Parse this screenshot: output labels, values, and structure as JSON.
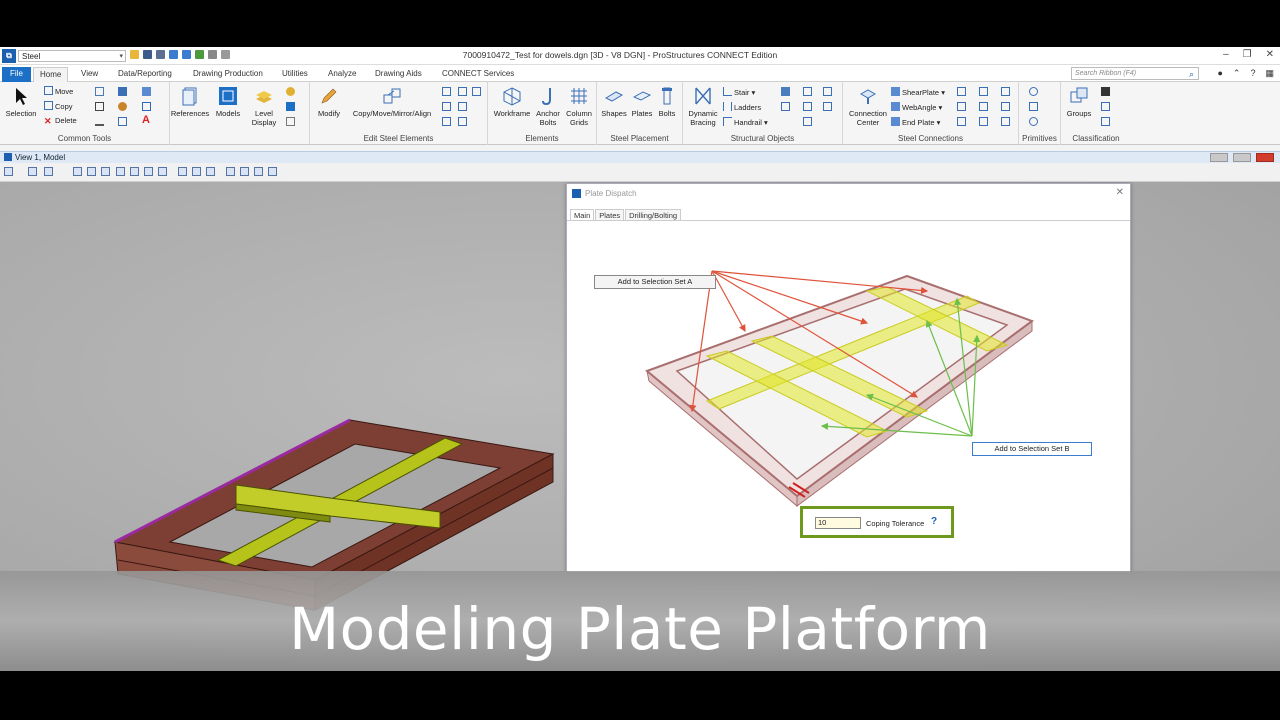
{
  "window": {
    "workspace": "Steel",
    "title": "7000910472_Test for dowels.dgn [3D - V8 DGN] - ProStructures CONNECT Edition"
  },
  "tabs": [
    {
      "label": "File"
    },
    {
      "label": "Home"
    },
    {
      "label": "View"
    },
    {
      "label": "Data/Reporting"
    },
    {
      "label": "Drawing Production"
    },
    {
      "label": "Utilities"
    },
    {
      "label": "Analyze"
    },
    {
      "label": "Drawing Aids"
    },
    {
      "label": "CONNECT Services"
    }
  ],
  "search": {
    "placeholder": "Search Ribbon (F4)"
  },
  "ribbon": {
    "common_tools": {
      "label": "Common Tools",
      "selection": "Selection",
      "move": "Move",
      "copy": "Copy",
      "delete": "Delete"
    },
    "references": "References",
    "models": "Models",
    "level_display": "Level Display",
    "edit_steel": {
      "label": "Edit Steel Elements",
      "modify": "Modify",
      "copy_move": "Copy/Move/Mirror/Align"
    },
    "elements": {
      "label": "Elements",
      "workframe": "Workframe",
      "anchor_bolts": "Anchor Bolts",
      "column_grids": "Column Grids"
    },
    "steel_placement": {
      "label": "Steel Placement",
      "shapes": "Shapes",
      "plates": "Plates",
      "bolts": "Bolts"
    },
    "structural_objects": {
      "label": "Structural Objects",
      "dynamic_bracing": "Dynamic Bracing",
      "stair": "Stair",
      "ladders": "Ladders",
      "handrail": "Handrail"
    },
    "steel_connections": {
      "label": "Steel Connections",
      "connection_center": "Connection Center",
      "shear_plate": "ShearPlate",
      "web_angle": "WebAngle",
      "end_plate": "End Plate"
    },
    "primitives": {
      "label": "Primitives"
    },
    "classification": {
      "label": "Classification",
      "groups": "Groups"
    }
  },
  "view": {
    "title": "View 1, Model"
  },
  "dialog": {
    "title": "Plate Dispatch",
    "tabs": [
      "Main",
      "Plates",
      "Drilling/Bolting"
    ],
    "callout_a": "Add to Selection Set A",
    "callout_b": "Add to Selection Set B",
    "tolerance_value": "10",
    "tolerance_label": "Coping Tolerance",
    "help": "?"
  },
  "caption": "Modeling Plate Platform",
  "colors": {
    "accent": "#1b6fc6",
    "steel_frame": "#6b2f22",
    "plates_highlight": "#b8c21a",
    "arrow_red": "#e0533a",
    "arrow_green": "#6bbf4a",
    "tolerance_border": "#6d9a1e"
  }
}
